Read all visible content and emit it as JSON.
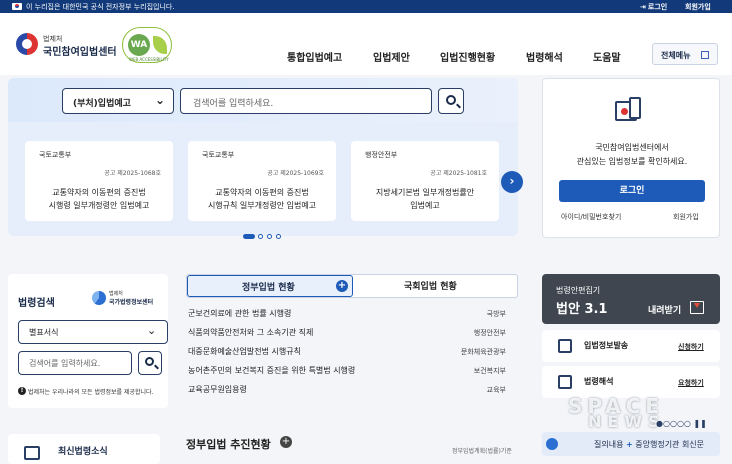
{
  "topbar": {
    "gov_notice": "이 누리집은 대한민국 공식 전자정부 누리집입니다.",
    "login": "로그인",
    "join": "회원가입"
  },
  "header": {
    "ministry": "법제처",
    "site_name": "국민참여입법센터",
    "wa_text": "WA",
    "wa_caption": "WEB ACCESSIBILITY",
    "nav": [
      "통합입법예고",
      "입법제안",
      "입법진행현황",
      "법령해석",
      "도움말"
    ],
    "all_menu": "전체메뉴"
  },
  "search": {
    "category": "(부처)입법예고",
    "placeholder": "검색어를 입력하세요."
  },
  "notices": [
    {
      "dept": "국토교통부",
      "number": "공고 제2025-1068호",
      "title_line1": "교통약자의 이동편의 증진법",
      "title_line2": "시행령 일부개정령안 입법예고"
    },
    {
      "dept": "국토교통부",
      "number": "공고 제2025-1069호",
      "title_line1": "교통약자의 이동편의 증진법",
      "title_line2": "시행규칙 일부개정령안 입법예고"
    },
    {
      "dept": "행정안전부",
      "number": "공고 제2025-1081호",
      "title_line1": "지방세기본법 일부개정법률안",
      "title_line2": "입법예고"
    }
  ],
  "login_card": {
    "message_line1": "국민참여입법센터에서",
    "message_line2": "관심있는 입법정보를 확인하세요.",
    "login_button": "로그인",
    "find_account": "아이디/비밀번호찾기",
    "join": "회원가입"
  },
  "law_search": {
    "title": "법령검색",
    "center_ministry": "법제처",
    "center_name": "국가법령정보센터",
    "select_value": "별표서식",
    "placeholder": "검색어를 입력하세요.",
    "note": "법제처는 우리나라의 모든 법령정보를 제공합니다."
  },
  "bill_tabs": {
    "active": "정부입법 현황",
    "inactive": "국회입법 현황"
  },
  "bills": [
    {
      "title": "군보건의료에 관한 법률 시행령",
      "dept": "국방부"
    },
    {
      "title": "식품의약품안전처와 그 소속기관 직제",
      "dept": "행정안전부"
    },
    {
      "title": "대중문화예술산업발전법 시행규칙",
      "dept": "문화체육관광부"
    },
    {
      "title": "농어촌주민의 보건복지 증진을 위한 특별법 시행령",
      "dept": "보건복지부"
    },
    {
      "title": "교육공무원임용령",
      "dept": "교육부"
    }
  ],
  "booklet": {
    "label": "법령안편집기",
    "version": "법안 3.1",
    "download": "내려받기"
  },
  "services": [
    {
      "name": "입법정보발송",
      "action": "신청하기"
    },
    {
      "name": "법령해석",
      "action": "요청하기"
    }
  ],
  "bottom": {
    "recent_laws": "최신법령소식",
    "progress_title": "정부입법 추진현황",
    "progress_link": "정부입법계획(법률)기준",
    "inquiry_text": "질의내용",
    "inquiry_target": "중앙행정기관 회신문"
  },
  "watermark": {
    "line1": "SPACE",
    "line2": "NEWS"
  },
  "colors": {
    "topbar": "#123a7a",
    "primary": "#1e5bb8",
    "dark_panel": "#3f4650"
  }
}
